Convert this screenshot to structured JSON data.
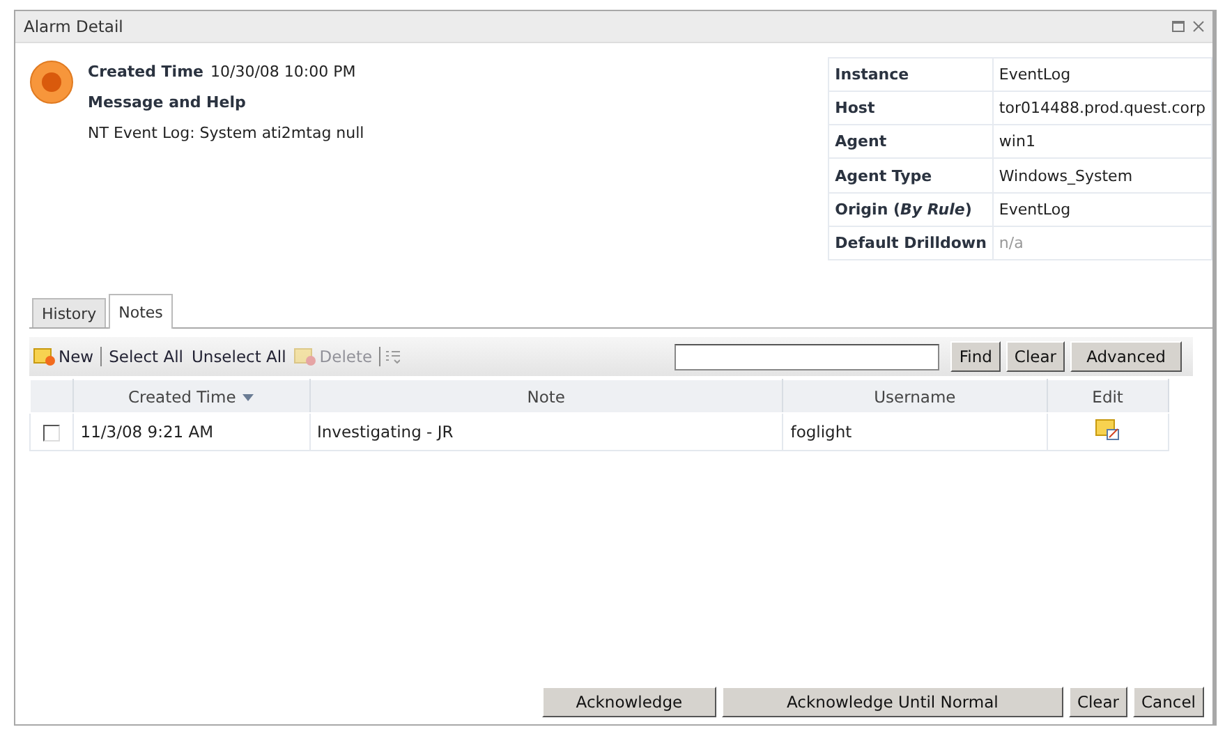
{
  "window": {
    "title": "Alarm Detail"
  },
  "alarm": {
    "created_label": "Created Time",
    "created_value": "10/30/08 10:00 PM",
    "message_heading": "Message and Help",
    "message": "NT Event Log: System ati2mtag null"
  },
  "properties": [
    {
      "label": "Instance",
      "value": "EventLog",
      "muted": false
    },
    {
      "label": "Host",
      "value": "tor014488.prod.quest.corp",
      "muted": false
    },
    {
      "label": "Agent",
      "value": "win1",
      "muted": false
    },
    {
      "label": "Agent Type",
      "value": "Windows_System",
      "muted": false
    },
    {
      "label": "Origin (*By Rule*)",
      "value": "EventLog",
      "muted": false
    },
    {
      "label": "Default Drilldown",
      "value": "n/a",
      "muted": true
    }
  ],
  "tabs": [
    {
      "label": "History",
      "selected": false
    },
    {
      "label": "Notes",
      "selected": true
    }
  ],
  "toolbar": {
    "items": [
      {
        "kind": "new",
        "label": "New",
        "disabled": false
      },
      {
        "kind": "divider"
      },
      {
        "kind": "text",
        "label": "Select All",
        "disabled": false
      },
      {
        "kind": "text",
        "label": "Unselect All",
        "disabled": false
      },
      {
        "kind": "delete",
        "label": "Delete",
        "disabled": true
      },
      {
        "kind": "divider"
      },
      {
        "kind": "columns"
      }
    ],
    "search_buttons": [
      "Find",
      "Clear",
      "Advanced"
    ]
  },
  "table": {
    "columns": [
      {
        "sorted": false
      },
      {
        "label": "Created Time",
        "sorted": true
      },
      {
        "label": "Note",
        "sorted": false
      },
      {
        "label": "Username",
        "sorted": false
      },
      {
        "label": "Edit",
        "sorted": false
      }
    ],
    "rows": [
      {
        "checked": false,
        "created_time": "11/3/08 9:21 AM",
        "note": "Investigating - JR",
        "username": "foglight"
      }
    ]
  },
  "buttons": [
    "Acknowledge",
    "Acknowledge Until Normal",
    "Clear",
    "Cancel"
  ]
}
